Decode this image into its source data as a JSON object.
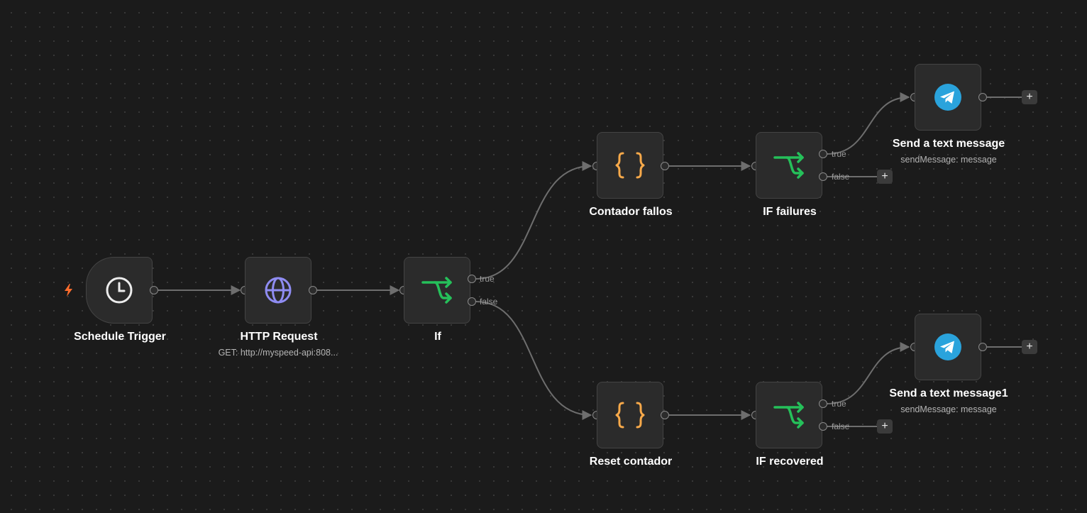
{
  "colors": {
    "canvas": "#1b1b1b",
    "node_bg": "#2b2b2b",
    "edge": "#6e6e6e",
    "if_icon": "#25c05a",
    "code_icon": "#f7a94a",
    "http_icon": "#8f8cf2",
    "telegram": "#2aa3dc",
    "trigger_bolt": "#ff6d2d"
  },
  "nodes": {
    "schedule": {
      "title": "Schedule Trigger",
      "icon": "clock-icon"
    },
    "http": {
      "title": "HTTP Request",
      "subtitle": "GET: http://myspeed-api:808...",
      "icon": "globe-icon"
    },
    "if": {
      "title": "If",
      "icon": "branch-icon",
      "outputs": [
        "true",
        "false"
      ]
    },
    "contador_fallos": {
      "title": "Contador fallos",
      "icon": "braces-icon"
    },
    "if_failures": {
      "title": "IF failures",
      "icon": "branch-icon",
      "outputs": [
        "true",
        "false"
      ]
    },
    "send_text": {
      "title": "Send a text message",
      "subtitle": "sendMessage: message",
      "icon": "telegram-icon"
    },
    "reset_contador": {
      "title": "Reset contador",
      "icon": "braces-icon"
    },
    "if_recovered": {
      "title": "IF recovered",
      "icon": "branch-icon",
      "outputs": [
        "true",
        "false"
      ]
    },
    "send_text1": {
      "title": "Send a text message1",
      "subtitle": "sendMessage: message",
      "icon": "telegram-icon"
    }
  },
  "add_button": "+"
}
